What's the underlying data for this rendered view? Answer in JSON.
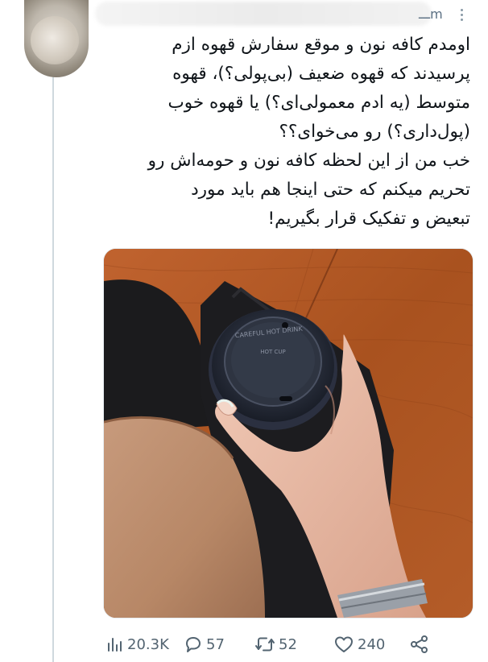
{
  "author": {
    "handle_tail": "‮م‬"
  },
  "tweet": {
    "text": "اومدم کافه نون و موقع سفارش قهوه ازم\nپرسیدند که قهوه ضعیف (بی‌پولی؟)، قهوه\nمتوسط (یه ادم معمولی‌ای؟) یا قهوه خوب\n(پول‌داری؟) رو می‌خوای؟؟\nخب من از این لحظه کافه نون و حومه‌اش رو\nتحریم میکنم که حتی اینجا هم باید مورد\nتبعیض و تفکیک قرار بگیریم!"
  },
  "media": {
    "cup_lid_text_top": "CAREFUL HOT DRINK",
    "cup_lid_text_mid": "HOT CUP"
  },
  "actions": {
    "views": "20.3K",
    "replies": "57",
    "retweets": "52",
    "likes": "240"
  },
  "icons": {
    "views": "views-bar-icon",
    "reply": "reply-bubble-icon",
    "retweet": "retweet-icon",
    "like": "heart-icon",
    "share": "share-icon",
    "more": "more-dots-icon"
  },
  "colors": {
    "icon_gray": "#536471",
    "thread_line": "#cfd9de",
    "text": "#0f1419"
  }
}
